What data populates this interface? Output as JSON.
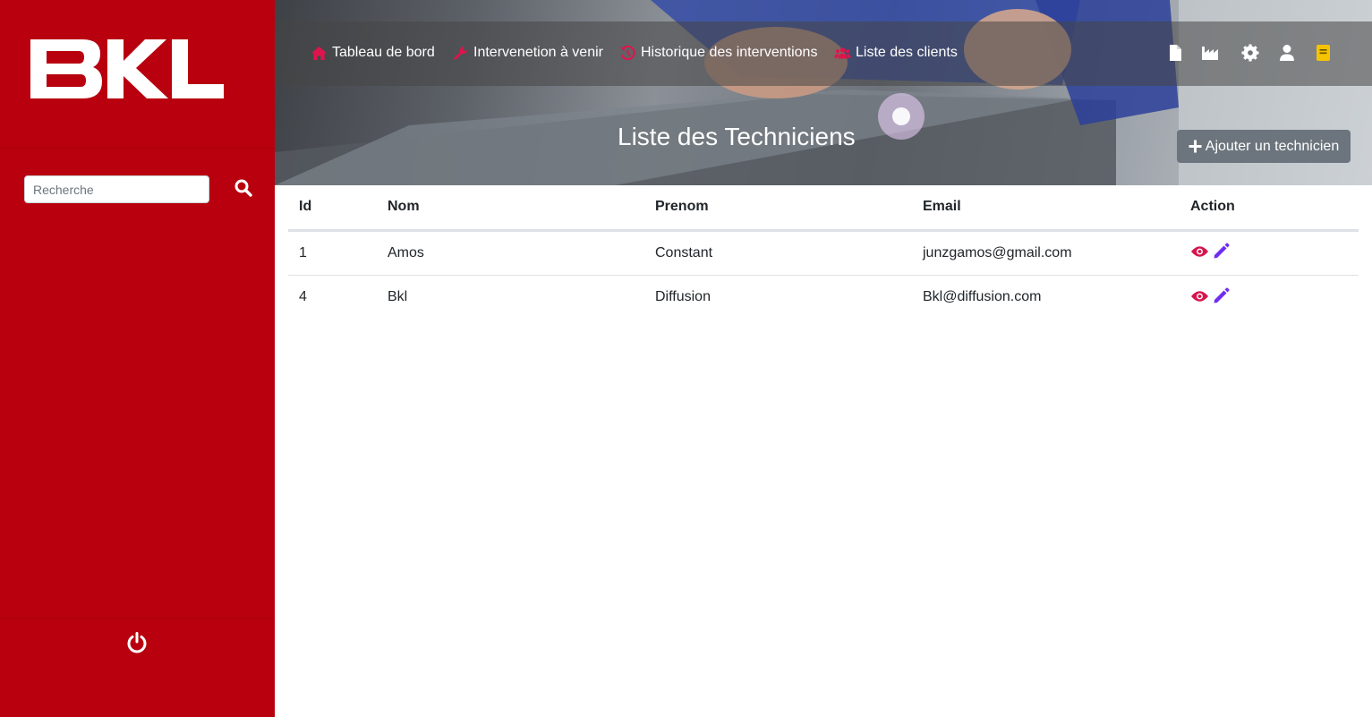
{
  "brand": {
    "logo_text": "BKL",
    "color": "#b8000f"
  },
  "sidebar": {
    "search": {
      "placeholder": "Recherche",
      "value": "",
      "icon": "search-icon"
    },
    "logout_icon": "power-icon"
  },
  "nav": {
    "items": [
      {
        "label": "Tableau de bord",
        "icon": "home-icon"
      },
      {
        "label": "Intervenetion à venir",
        "icon": "wrench-icon"
      },
      {
        "label": "Historique des interventions",
        "icon": "history-icon"
      },
      {
        "label": "Liste des clients",
        "icon": "users-icon"
      }
    ],
    "right_icons": [
      "file-icon",
      "industry-icon",
      "gear-icon",
      "user-icon",
      "notebook-icon"
    ],
    "icon_accent": "#e0144c",
    "notebook_color": "#f5c400"
  },
  "header": {
    "title": "Liste des Techniciens",
    "add_button": "Ajouter un technicien"
  },
  "table": {
    "columns": [
      "Id",
      "Nom",
      "Prenom",
      "Email",
      "Action"
    ],
    "rows": [
      {
        "id": "1",
        "nom": "Amos",
        "prenom": "Constant",
        "email": "junzgamos@gmail.com"
      },
      {
        "id": "4",
        "nom": "Bkl",
        "prenom": "Diffusion",
        "email": "Bkl@diffusion.com"
      }
    ],
    "action_icons": [
      "eye-icon",
      "pencil-icon"
    ],
    "view_color": "#d6154d",
    "edit_color": "#6f2cf3"
  }
}
